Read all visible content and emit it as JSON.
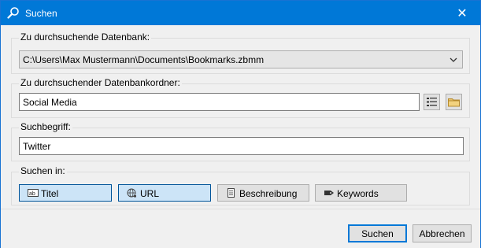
{
  "window": {
    "title": "Suchen",
    "title_icon": "magnifier-icon",
    "close_glyph": "✕"
  },
  "database_group": {
    "label": "Zu durchsuchende Datenbank:",
    "selected_value": "C:\\Users\\Max Mustermann\\Documents\\Bookmarks.zbmm"
  },
  "folder_group": {
    "label": "Zu durchsuchender Datenbankordner:",
    "value": "Social Media",
    "icons": [
      "folder-tree-icon",
      "folder-icon"
    ]
  },
  "term_group": {
    "label": "Suchbegriff:",
    "value": "Twitter"
  },
  "search_in_group": {
    "label": "Suchen in:",
    "options": [
      {
        "label": "Titel",
        "icon": "text-field-icon",
        "active": true
      },
      {
        "label": "URL",
        "icon": "globe-link-icon",
        "active": true
      },
      {
        "label": "Beschreibung",
        "icon": "document-icon",
        "active": false
      },
      {
        "label": "Keywords",
        "icon": "tag-icon",
        "active": false
      }
    ]
  },
  "footer": {
    "search_label": "Suchen",
    "cancel_label": "Abbrechen"
  },
  "colors": {
    "titlebar": "#0078d7",
    "active_toggle": "#cce4f7",
    "active_toggle_border": "#005499"
  }
}
